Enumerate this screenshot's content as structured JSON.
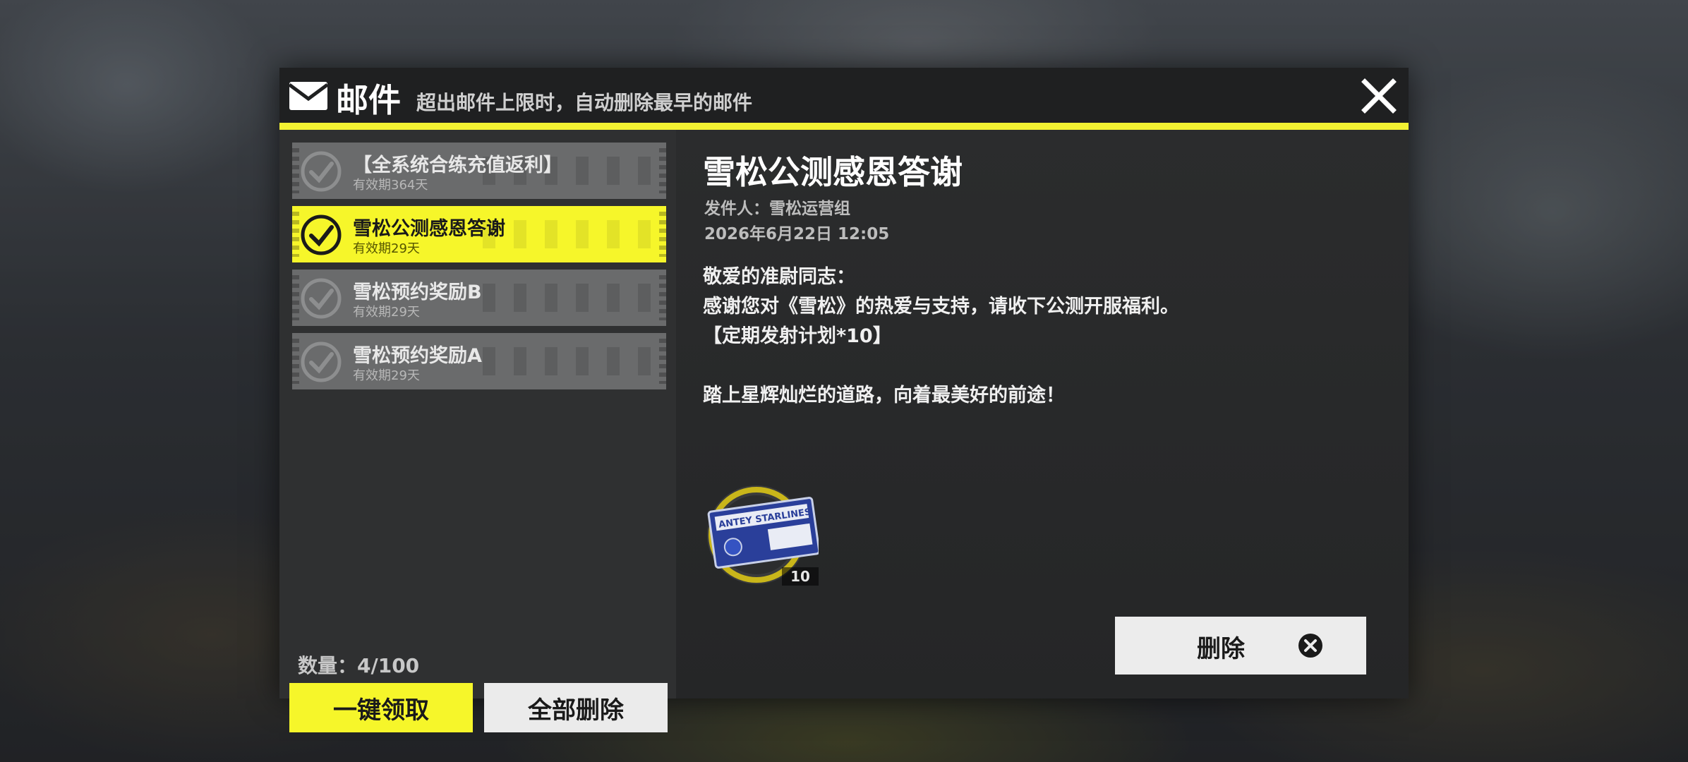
{
  "header": {
    "title": "邮件",
    "subtitle": "超出邮件上限时，自动删除最早的邮件"
  },
  "mail_list": {
    "items": [
      {
        "title": "【全系统合练充值返利】",
        "validity": "有效期364天",
        "selected": false
      },
      {
        "title": "雪松公测感恩答谢",
        "validity": "有效期29天",
        "selected": true
      },
      {
        "title": "雪松预约奖励B",
        "validity": "有效期29天",
        "selected": false
      },
      {
        "title": "雪松预约奖励A",
        "validity": "有效期29天",
        "selected": false
      }
    ],
    "count_label": "数量：4/100",
    "claim_all_label": "一键领取",
    "delete_all_label": "全部删除"
  },
  "detail": {
    "title": "雪松公测感恩答谢",
    "sender": "发件人：雪松运营组",
    "date": "2026年6月22日  12:05",
    "body": [
      "敬爱的准尉同志：",
      "感谢您对《雪松》的热爱与支持，请收下公测开服福利。",
      "【定期发射计划*10】",
      "踏上星辉灿烂的道路，向着最美好的前途！"
    ],
    "reward": {
      "icon": "launch-ticket-icon",
      "ticket_text": "ANTEY STARLINES",
      "count": "10"
    },
    "delete_label": "删除"
  },
  "colors": {
    "accent": "#f6f62a",
    "panel": "#262728",
    "item_inactive": "#6a6b6c"
  }
}
